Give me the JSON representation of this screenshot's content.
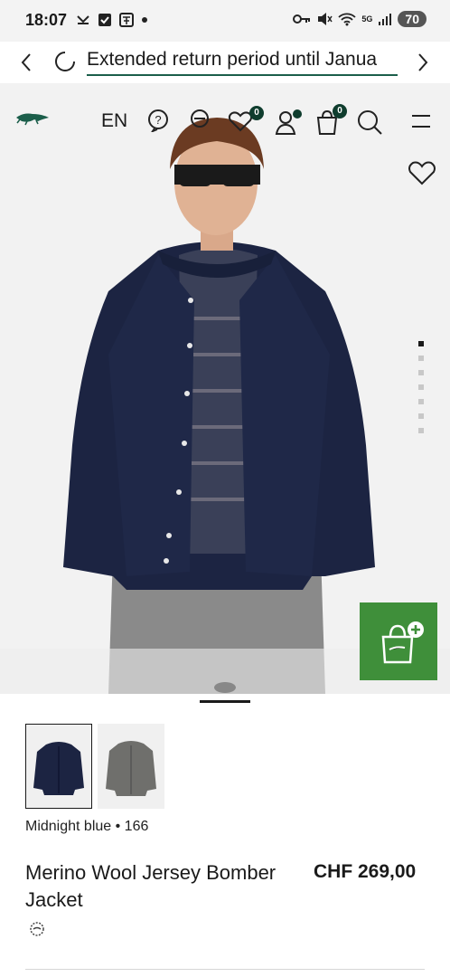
{
  "status_bar": {
    "time": "18:07",
    "battery": "70",
    "network": "5G"
  },
  "promo": {
    "text": "Extended return period until Janua"
  },
  "nav": {
    "language": "EN",
    "wishlist_count": "0",
    "cart_count": "0"
  },
  "gallery": {
    "image_count": 7,
    "active_index": 0
  },
  "product": {
    "color_label": "Midnight blue • 166",
    "title": "Merino Wool Jersey Bomber Jacket",
    "price": "CHF 269,00"
  },
  "colors": {
    "brand_green": "#3f8f3a",
    "dark_green": "#0f3d2e",
    "jacket_navy": "#1c2442",
    "trousers_grey": "#8a8a8a"
  }
}
